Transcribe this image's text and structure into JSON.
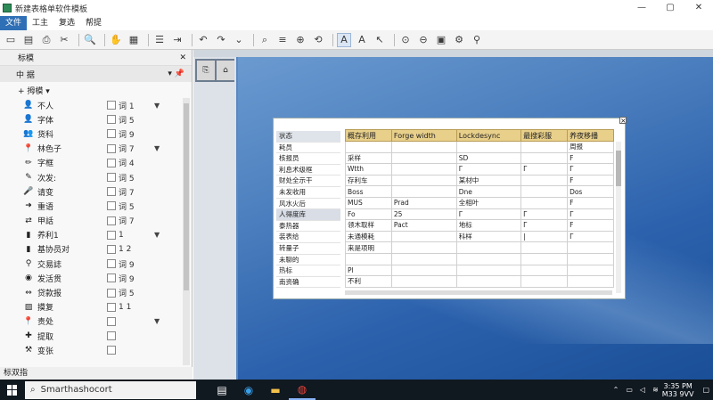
{
  "window": {
    "title": "新建表格单软件模板",
    "controls": [
      "—",
      "▢",
      "✕"
    ]
  },
  "menu": {
    "items": [
      "文件",
      "工主",
      "复选",
      "帮提"
    ],
    "active_index": 0
  },
  "toolbar": {
    "icons": [
      "open-icon",
      "save-icon",
      "print-icon",
      "cut-icon",
      "copy-icon",
      "paste-icon",
      "find-icon",
      "format-icon",
      "align-icon",
      "indent-icon",
      "undo-icon",
      "redo-icon",
      "zoom-icon",
      "text-icon",
      "font-icon",
      "zoom-in-icon",
      "zoom-out-icon",
      "image-icon",
      "link-icon",
      "color-icon"
    ]
  },
  "left_panel": {
    "header": "标模",
    "subheader": "中 据",
    "group": "+ 拇模 ▾",
    "rows": [
      {
        "icon": "user-icon",
        "label": "不人",
        "value": "词 1",
        "dropdown": true
      },
      {
        "icon": "user-icon",
        "label": "字体",
        "value": "词 5"
      },
      {
        "icon": "group-icon",
        "label": "货科",
        "value": "词 9"
      },
      {
        "icon": "pin-icon",
        "label": "林色子",
        "value": "词 7",
        "dropdown": true
      },
      {
        "icon": "tool-icon",
        "label": "字框",
        "value": "词 4"
      },
      {
        "icon": "edit-icon",
        "label": "次发:",
        "value": "词 5"
      },
      {
        "icon": "mic-icon",
        "label": "请变",
        "value": "词 7"
      },
      {
        "icon": "arrow-icon",
        "label": "重语",
        "value": "词 5"
      },
      {
        "icon": "swap-icon",
        "label": "甲話",
        "value": "词 7"
      },
      {
        "icon": "chart-icon",
        "label": "养利1",
        "value": "1",
        "dropdown": true
      },
      {
        "icon": "chart-icon",
        "label": "基协员对",
        "value": "1 2"
      },
      {
        "icon": "link-icon",
        "label": "交易誌",
        "value": "词 9"
      },
      {
        "icon": "circle-icon",
        "label": "发活贯",
        "value": "词 9"
      },
      {
        "icon": "arrows-icon",
        "label": "贷款报",
        "value": "词 5"
      },
      {
        "icon": "image-icon",
        "label": "摸复",
        "value": "1 1"
      },
      {
        "icon": "pin-icon",
        "label": "责处",
        "value": "",
        "dropdown": true
      },
      {
        "icon": "plus-icon",
        "label": "提取",
        "value": ""
      },
      {
        "icon": "tools-icon",
        "label": "变张",
        "value": ""
      }
    ],
    "footer": "标双指"
  },
  "table": {
    "left_col": [
      "状态",
      "耗员",
      "核报员",
      "利息术级框",
      "财处全示干",
      "未发收用",
      "风水火后",
      "人得度库",
      "泰热器",
      "装表给",
      "转量子",
      "未聊的",
      "热标",
      "南资确"
    ],
    "headers": [
      "概存利用",
      "Forge width",
      "Lockdesync",
      "最搜彩服",
      "养夜移播"
    ],
    "rows": [
      [
        "",
        "",
        "",
        "",
        "周报"
      ],
      [
        "采样",
        "",
        "SD",
        "",
        "F"
      ],
      [
        "Wtth",
        "",
        "Г",
        "Г",
        "Г"
      ],
      [
        "存利车",
        "",
        "某材中",
        "",
        "F"
      ],
      [
        "Boss",
        "",
        "Dne",
        "",
        "Dos"
      ],
      [
        "MUS",
        "Prad",
        "全相叶",
        "",
        "F"
      ],
      [
        "Fo",
        "25",
        "Г",
        "Г",
        "Г"
      ],
      [
        "领木取样",
        "Pact",
        "地标",
        "Г",
        "F"
      ],
      [
        "未通模耗",
        "",
        "科样",
        "|",
        "Г"
      ],
      [
        "来是项明",
        "",
        "",
        "",
        ""
      ],
      [
        "",
        "",
        "",
        "",
        ""
      ],
      [
        "Pl",
        "",
        "",
        "",
        ""
      ],
      [
        "不利",
        "",
        "",
        "",
        ""
      ]
    ]
  },
  "taskbar": {
    "search_text": "Smarthashocort",
    "apps": [
      "taskview-icon",
      "edge-icon",
      "folder-icon",
      "chrome-icon"
    ],
    "clock_time": "3:35 PM",
    "clock_date": "M33 9VV"
  }
}
